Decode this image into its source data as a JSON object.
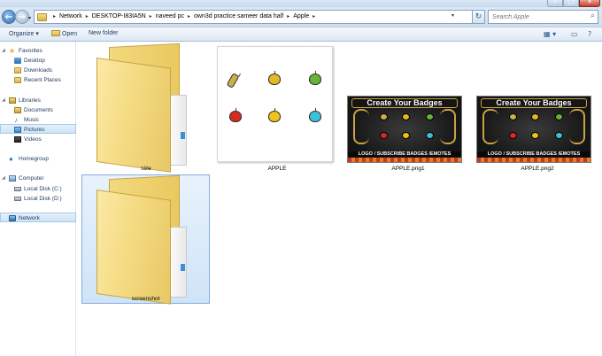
{
  "window": {
    "controls": {
      "minimize": "–",
      "maximize": "□",
      "close": "✕"
    }
  },
  "address": {
    "back_glyph": "←",
    "forward_glyph": "→",
    "breadcrumbs": [
      "Network",
      "DESKTOP-I83IA5N",
      "naveed pc",
      "own3d practice sameer data half",
      "Apple"
    ],
    "separator": "▸",
    "refresh_glyph": "↻",
    "search_placeholder": "Search Apple"
  },
  "toolbar": {
    "organize_label": "Organize ▾",
    "open_label": "Open",
    "new_folder_label": "New folder",
    "view_glyph": "▦ ▾",
    "preview_glyph": "▭",
    "help_glyph": "?"
  },
  "nav": {
    "favorites": {
      "label": "Favorites",
      "items": [
        "Desktop",
        "Downloads",
        "Recent Places"
      ]
    },
    "libraries": {
      "label": "Libraries",
      "items": [
        "Documents",
        "Music",
        "Pictures",
        "Videos"
      ]
    },
    "homegroup": "Homegroup",
    "computer": {
      "label": "Computer",
      "items": [
        "Local Disk (C:)",
        "Local Disk (D:)"
      ]
    },
    "network": "Network"
  },
  "files": [
    {
      "name": "size",
      "type": "folder"
    },
    {
      "name": "APPLE",
      "type": "image"
    },
    {
      "name": "APPLE.png1",
      "type": "image"
    },
    {
      "name": "APPLE.png2",
      "type": "image"
    },
    {
      "name": "screenshot",
      "type": "folder",
      "selected": true
    }
  ],
  "badge_image": {
    "title": "Create Your Badges",
    "bottom_text": "LOGO / SUBSCRIBE BADGES /EMOTES"
  },
  "colors": {
    "selection": "#cfe4f8",
    "accent": "#1e395b",
    "folder": "#f5dc85"
  }
}
